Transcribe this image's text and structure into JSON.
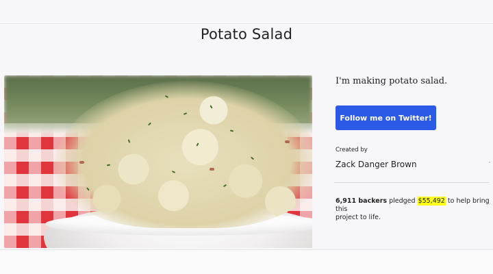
{
  "page": {
    "title": "Potato Salad"
  },
  "hero": {
    "image_alt": "bowl of potato salad"
  },
  "project": {
    "blurb": "I'm making potato salad.",
    "follow_button": "Follow me on Twitter!",
    "created_by_label": "Created by",
    "creator_name": "Zack Danger Brown"
  },
  "funding": {
    "backers": "6,911 backers",
    "pledged_text": "pledged",
    "amount": "$55,492",
    "line_end": "to help bring this",
    "line2": "project to life."
  },
  "colors": {
    "button": "#2b5ae6",
    "highlight": "#ffff1c",
    "background": "#f7f7f9"
  }
}
